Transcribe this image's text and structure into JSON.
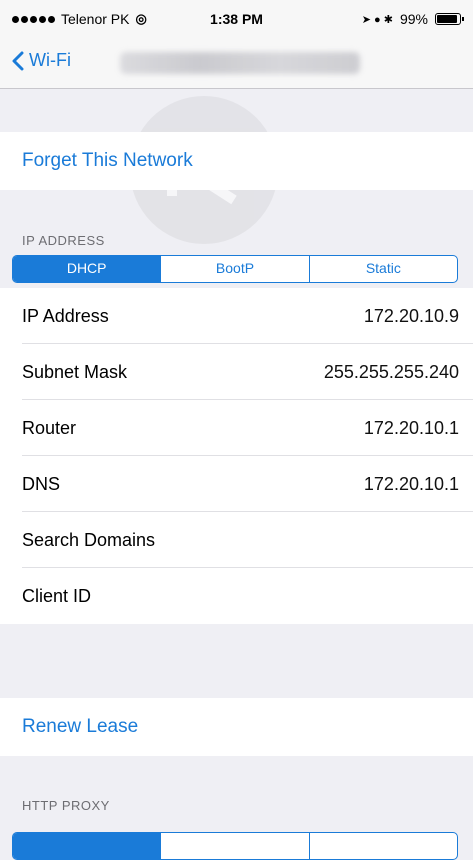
{
  "status_bar": {
    "carrier": "Telenor PK",
    "wifi_symbol": "◎",
    "time": "1:38 PM",
    "icons": "➤ ● ✱",
    "battery_text": "99%",
    "battery_level": 0.99
  },
  "nav": {
    "back_label": "Wi-Fi",
    "network_name": ""
  },
  "forget": {
    "label": "Forget This Network"
  },
  "ip_section": {
    "header": "IP ADDRESS",
    "segments": [
      "DHCP",
      "BootP",
      "Static"
    ],
    "selected": 0
  },
  "rows": [
    {
      "label": "IP Address",
      "value": "172.20.10.9"
    },
    {
      "label": "Subnet Mask",
      "value": "255.255.255.240"
    },
    {
      "label": "Router",
      "value": "172.20.10.1"
    },
    {
      "label": "DNS",
      "value": "172.20.10.1"
    },
    {
      "label": "Search Domains",
      "value": ""
    },
    {
      "label": "Client ID",
      "value": ""
    }
  ],
  "renew": {
    "label": "Renew Lease"
  },
  "proxy_section": {
    "header": "HTTP PROXY"
  },
  "colors": {
    "accent": "#1a7bd8",
    "background": "#efeff4"
  }
}
